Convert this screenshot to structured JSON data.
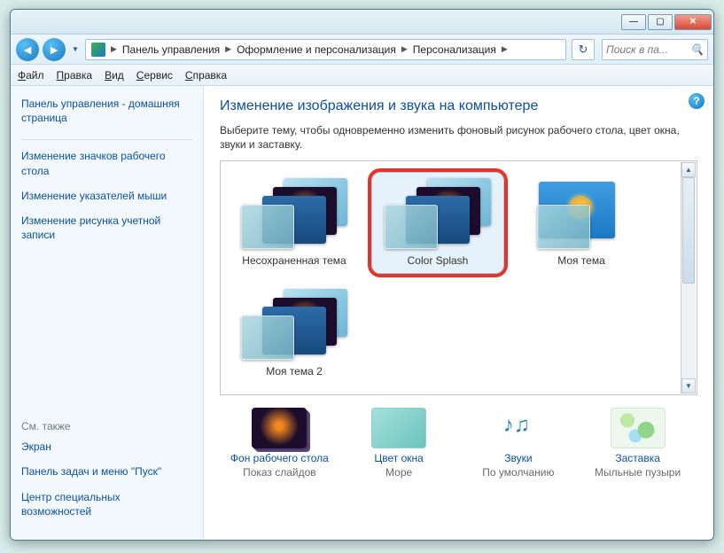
{
  "window": {
    "minimize": "—",
    "maximize": "▢",
    "close": "✕"
  },
  "breadcrumbs": {
    "cp": "Панель управления",
    "appear": "Оформление и персонализация",
    "pers": "Персонализация"
  },
  "search": {
    "placeholder": "Поиск в па..."
  },
  "menu": {
    "file": "Файл",
    "edit": "Правка",
    "view": "Вид",
    "tools": "Сервис",
    "help": "Справка"
  },
  "sidebar": {
    "home": "Панель управления - домашняя страница",
    "tasks": {
      "0": "Изменение значков рабочего стола",
      "1": "Изменение указателей мыши",
      "2": "Изменение рисунка учетной записи"
    },
    "seealso_h": "См. также",
    "seealso": {
      "0": "Экран",
      "1": "Панель задач и меню \"Пуск\"",
      "2": "Центр специальных возможностей"
    }
  },
  "main": {
    "title": "Изменение изображения и звука на компьютере",
    "intro": "Выберите тему, чтобы одновременно изменить фоновый рисунок рабочего стола, цвет окна, звуки и заставку.",
    "themes": {
      "0": "Несохраненная тема",
      "1": "Color Splash",
      "2": "Моя тема",
      "3": "Моя тема 2"
    },
    "bottom": {
      "bg_link": "Фон рабочего стола",
      "bg_sub": "Показ слайдов",
      "color_link": "Цвет окна",
      "color_sub": "Море",
      "sound_link": "Звуки",
      "sound_sub": "По умолчанию",
      "saver_link": "Заставка",
      "saver_sub": "Мыльные пузыри"
    }
  }
}
